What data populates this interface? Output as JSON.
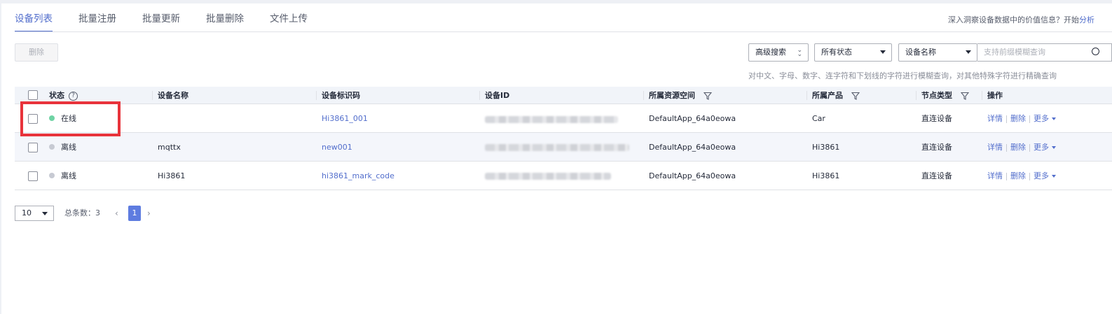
{
  "tabs": [
    "设备列表",
    "批量注册",
    "批量更新",
    "批量删除",
    "文件上传"
  ],
  "insight": {
    "text": "深入洞察设备数据中的价值信息？开始",
    "link": "分析"
  },
  "toolbar": {
    "delete_label": "删除",
    "advanced_search": "高级搜索",
    "status_filter": "所有状态",
    "field_select": "设备名称",
    "search_placeholder": "支持前缀模糊查询",
    "hint": "对中文、字母、数字、连字符和下划线的字符进行模糊查询，对其他特殊字符进行精确查询"
  },
  "table": {
    "headers": {
      "status": "状态",
      "name": "设备名称",
      "identifier": "设备标识码",
      "id": "设备ID",
      "space": "所属资源空间",
      "product": "所属产品",
      "node_type": "节点类型",
      "actions": "操作"
    },
    "rows": [
      {
        "status": "在线",
        "name": "",
        "identifier": "Hi3861_001",
        "space": "DefaultApp_64a0eowa",
        "product": "Car",
        "node_type": "直连设备"
      },
      {
        "status": "离线",
        "name": "mqttx",
        "identifier": "new001",
        "space": "DefaultApp_64a0eowa",
        "product": "Hi3861",
        "node_type": "直连设备"
      },
      {
        "status": "离线",
        "name": "Hi3861",
        "identifier": "hi3861_mark_code",
        "space": "DefaultApp_64a0eowa",
        "product": "Hi3861",
        "node_type": "直连设备"
      }
    ],
    "actions": {
      "detail": "详情",
      "delete": "删除",
      "more": "更多"
    }
  },
  "pagination": {
    "page_size": "10",
    "total_label": "总条数：3",
    "current_page": "1"
  },
  "colors": {
    "accent": "#526ecc",
    "online": "#6fd3a4",
    "offline": "#c7cad3",
    "highlight": "#e8333b"
  }
}
